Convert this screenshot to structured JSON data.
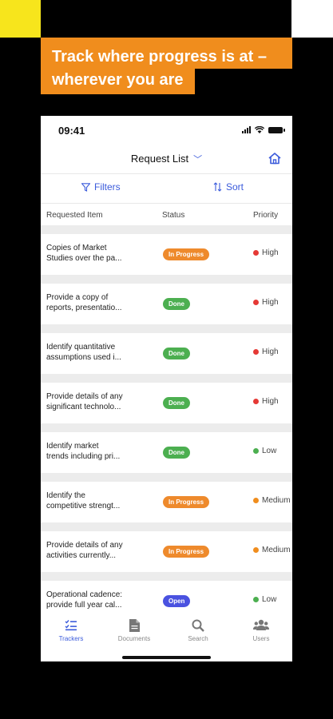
{
  "headline": {
    "line1": "Track where progress is at –",
    "line2": "wherever you are"
  },
  "status_bar": {
    "time": "09:41"
  },
  "nav": {
    "title": "Request List"
  },
  "toolbar": {
    "filters": "Filters",
    "sort": "Sort"
  },
  "columns": {
    "item": "Requested Item",
    "status": "Status",
    "priority": "Priority"
  },
  "rows": [
    {
      "item": "Copies of Market\nStudies over the pa...",
      "status": "In Progress",
      "priority": "High"
    },
    {
      "item": "Provide a copy of\nreports, presentatio...",
      "status": "Done",
      "priority": "High"
    },
    {
      "item": "Identify quantitative\nassumptions used i...",
      "status": "Done",
      "priority": "High"
    },
    {
      "item": "Provide details of any\nsignificant technolo...",
      "status": "Done",
      "priority": "High"
    },
    {
      "item": "Identify market\ntrends including pri...",
      "status": "Done",
      "priority": "Low"
    },
    {
      "item": "Identify the\ncompetitive strengt...",
      "status": "In Progress",
      "priority": "Medium"
    },
    {
      "item": "Provide details of any\nactivities currently...",
      "status": "In Progress",
      "priority": "Medium"
    },
    {
      "item": "Operational cadence:\nprovide full year cal...",
      "status": "Open",
      "priority": "Low"
    }
  ],
  "tabs": [
    {
      "label": "Trackers",
      "icon": "checklist-icon"
    },
    {
      "label": "Documents",
      "icon": "document-icon"
    },
    {
      "label": "Search",
      "icon": "search-icon"
    },
    {
      "label": "Users",
      "icon": "users-icon"
    }
  ],
  "colors": {
    "accent": "#3b5bdb",
    "headline_bg": "#f08d1d",
    "status_in_progress": "#ee8a2c",
    "status_done": "#4caf50",
    "status_open": "#4a52e0",
    "priority_high": "#e53935",
    "priority_medium": "#f08d1d",
    "priority_low": "#4caf50"
  }
}
